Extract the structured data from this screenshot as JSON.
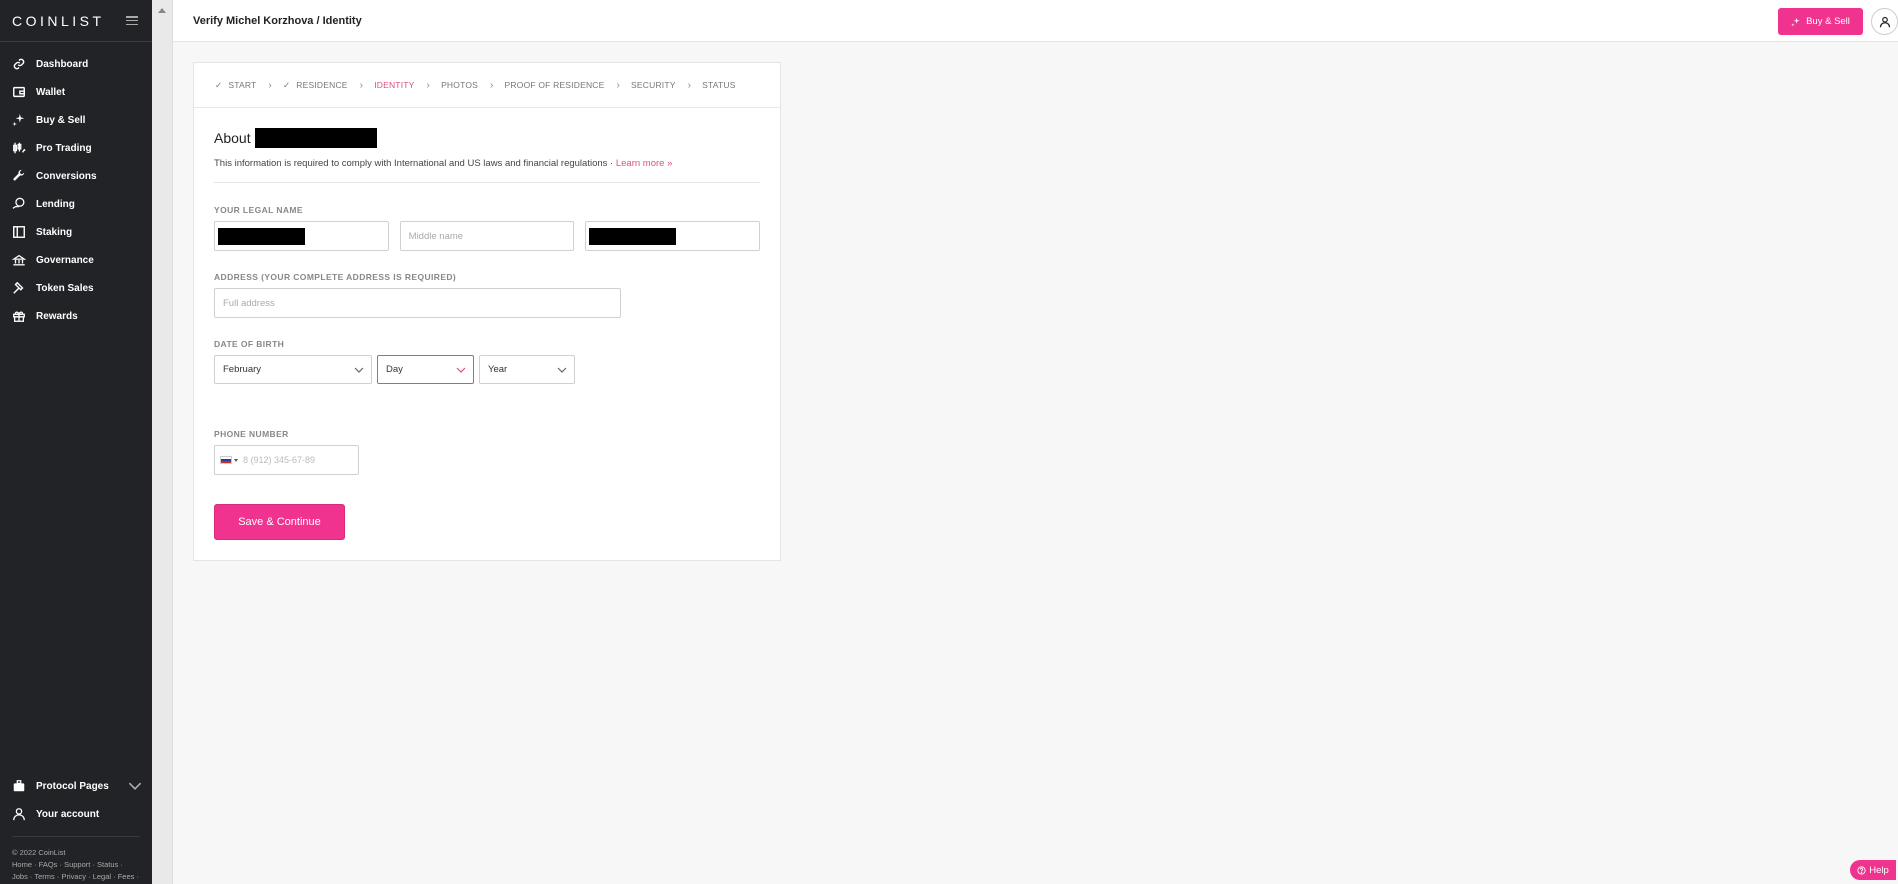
{
  "sidebar": {
    "logo": "COINLIST",
    "items": [
      {
        "label": "Dashboard",
        "icon": "link-icon"
      },
      {
        "label": "Wallet",
        "icon": "wallet-icon"
      },
      {
        "label": "Buy & Sell",
        "icon": "sparkle-icon"
      },
      {
        "label": "Pro Trading",
        "icon": "trading-icon"
      },
      {
        "label": "Conversions",
        "icon": "wrench-icon"
      },
      {
        "label": "Lending",
        "icon": "lending-icon"
      },
      {
        "label": "Staking",
        "icon": "staking-icon"
      },
      {
        "label": "Governance",
        "icon": "governance-icon"
      },
      {
        "label": "Token Sales",
        "icon": "hammer-icon"
      },
      {
        "label": "Rewards",
        "icon": "gift-icon"
      }
    ],
    "bottom_items": [
      {
        "label": "Protocol Pages",
        "icon": "briefcase-icon"
      },
      {
        "label": "Your account",
        "icon": "user-icon"
      }
    ],
    "copyright": "© 2022 CoinList",
    "footer_line1": "Home · FAQs · Support · Status ·",
    "footer_line2": "Jobs · Terms · Privacy · Legal · Fees ·"
  },
  "header": {
    "title": "Verify Michel Korzhova / Identity",
    "buy_sell_label": "Buy & Sell"
  },
  "steps": [
    {
      "label": "START",
      "done": true
    },
    {
      "label": "RESIDENCE",
      "done": true
    },
    {
      "label": "IDENTITY",
      "active": true
    },
    {
      "label": "PHOTOS"
    },
    {
      "label": "PROOF OF RESIDENCE"
    },
    {
      "label": "SECURITY"
    },
    {
      "label": "STATUS"
    }
  ],
  "form": {
    "about": "About",
    "info_text": "This information is required to comply with International and US laws and financial regulations · ",
    "learn_more": "Learn more »",
    "legal_name_label": "YOUR LEGAL NAME",
    "middle_name_placeholder": "Middle name",
    "address_label": "ADDRESS (YOUR COMPLETE ADDRESS IS REQUIRED)",
    "address_placeholder": "Full address",
    "dob_label": "DATE OF BIRTH",
    "dob_month": "February",
    "dob_day": "Day",
    "dob_year": "Year",
    "phone_label": "PHONE NUMBER",
    "phone_placeholder": "8 (912) 345-67-89",
    "save_label": "Save & Continue"
  },
  "help_label": "Help",
  "colors": {
    "accent": "#f0338e",
    "sidebar_bg": "#222327",
    "active_step": "#e24c84"
  }
}
